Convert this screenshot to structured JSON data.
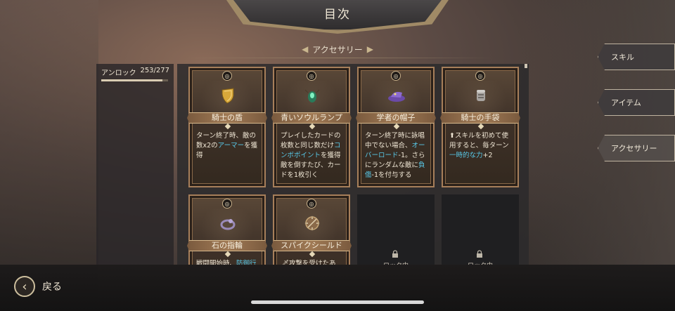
{
  "title": "目次",
  "category": {
    "label": "アクセサリー",
    "prev_icon": "triangle-left-icon",
    "next_icon": "triangle-right-icon"
  },
  "character": {
    "name": "アンロック",
    "hp": "253/277",
    "hp_fraction": 0.913
  },
  "cards": [
    {
      "name": "騎士の盾",
      "icon": "gold-shield-icon",
      "desc": [
        {
          "t": "ターン終了時、敵の数x2の"
        },
        {
          "t": "アーマー",
          "hl": true
        },
        {
          "t": "を獲得"
        }
      ]
    },
    {
      "name": "青いソウルランプ",
      "icon": "green-beetle-lamp-icon",
      "desc": [
        {
          "t": "プレイしたカードの枚数と同じ数だけ"
        },
        {
          "t": "コンボポイント",
          "hl": true
        },
        {
          "t": "を獲得 敵を倒すたび、カードを1枚引く"
        }
      ]
    },
    {
      "name": "学者の帽子",
      "icon": "purple-hat-icon",
      "desc": [
        {
          "t": "ターン終了時に詠唱中でない場合、"
        },
        {
          "t": "オーバーロード",
          "hl": true
        },
        {
          "t": "-1。さらにランダムな敵に"
        },
        {
          "t": "負傷",
          "hl": true
        },
        {
          "t": "-1を付与する"
        }
      ]
    },
    {
      "name": "騎士の手袋",
      "icon": "gauntlet-icon",
      "desc": [
        {
          "t": "⬆スキルを初めて使用すると、毎ターン"
        },
        {
          "t": "一時的な力",
          "hl": true
        },
        {
          "t": "+2"
        }
      ]
    },
    {
      "name": "石の指輪",
      "icon": "stone-ring-icon",
      "desc": [
        {
          "t": "戦闘開始時、"
        },
        {
          "t": "防御行",
          "hl": true
        }
      ]
    },
    {
      "name": "スパイクシールド",
      "icon": "spiked-shield-icon",
      "desc": [
        {
          "t": "🗡攻撃を受けたあ"
        }
      ]
    }
  ],
  "locked_cards": [
    {
      "label": "ロック中",
      "icon": "lock-icon"
    },
    {
      "label": "ロック中",
      "icon": "lock-icon"
    }
  ],
  "tabs": [
    {
      "label": "スキル",
      "active": false
    },
    {
      "label": "アイテム",
      "active": false
    },
    {
      "label": "アクセサリー",
      "active": true
    }
  ],
  "back": {
    "label": "戻る",
    "icon": "chevron-left-icon"
  },
  "colors": {
    "highlight": "#58c8e8",
    "card_border": "#a77f5a"
  }
}
